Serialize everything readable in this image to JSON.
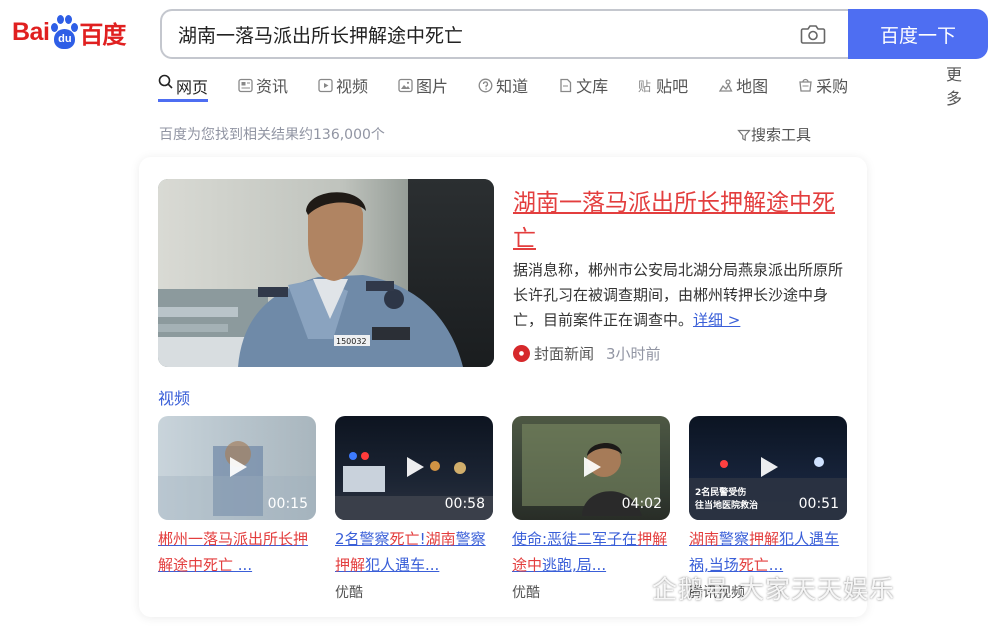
{
  "brand": {
    "logo_latin": "Bai",
    "logo_paw_text": "du",
    "logo_cn": "百度",
    "primary_color": "#4e6ef2",
    "logo_red": "#e02020",
    "highlight_red": "#e33e3e",
    "link_blue": "#3a5fd8"
  },
  "search": {
    "query": "湖南一落马派出所长押解途中死亡",
    "button_label": "百度一下",
    "camera_icon": "camera-icon"
  },
  "tabs": [
    {
      "label": "网页",
      "icon": "search-icon",
      "active": true
    },
    {
      "label": "资讯",
      "icon": "news-icon"
    },
    {
      "label": "视频",
      "icon": "video-icon"
    },
    {
      "label": "图片",
      "icon": "image-icon"
    },
    {
      "label": "知道",
      "icon": "question-icon"
    },
    {
      "label": "文库",
      "icon": "document-icon"
    },
    {
      "label": "贴吧",
      "icon": "tieba-icon"
    },
    {
      "label": "地图",
      "icon": "map-icon"
    },
    {
      "label": "采购",
      "icon": "cart-icon"
    },
    {
      "label": "更多"
    }
  ],
  "results_bar": {
    "count_text": "百度为您找到相关结果约136,000个",
    "tools_label": "搜索工具"
  },
  "news": {
    "title": "湖南一落马派出所长押解途中死亡",
    "summary": "据消息称，郴州市公安局北湖分局燕泉派出所原所长许孔习在被调查期间，由郴州转押长沙途中身亡，目前案件正在调查中。",
    "more_label": "详细 >",
    "source": "封面新闻",
    "time": "3小时前",
    "badge_number": "150032"
  },
  "videos": {
    "heading": "视频",
    "items": [
      {
        "title": "郴州一落马派出所长押解途中死亡 ...",
        "duration": "00:15",
        "source": ""
      },
      {
        "title": "2名警察死亡!湖南警察押解犯人遇车...",
        "duration": "00:58",
        "source": "优酷"
      },
      {
        "title": "使命:恶徒二军子在押解途中逃跑,局...",
        "duration": "04:02",
        "source": "优酷"
      },
      {
        "title": "湖南警察押解犯人遇车祸,当场死亡...",
        "duration": "00:51",
        "source": "腾讯视频"
      }
    ]
  },
  "watermark": {
    "text": "企鹅号 大家天天娱乐"
  }
}
